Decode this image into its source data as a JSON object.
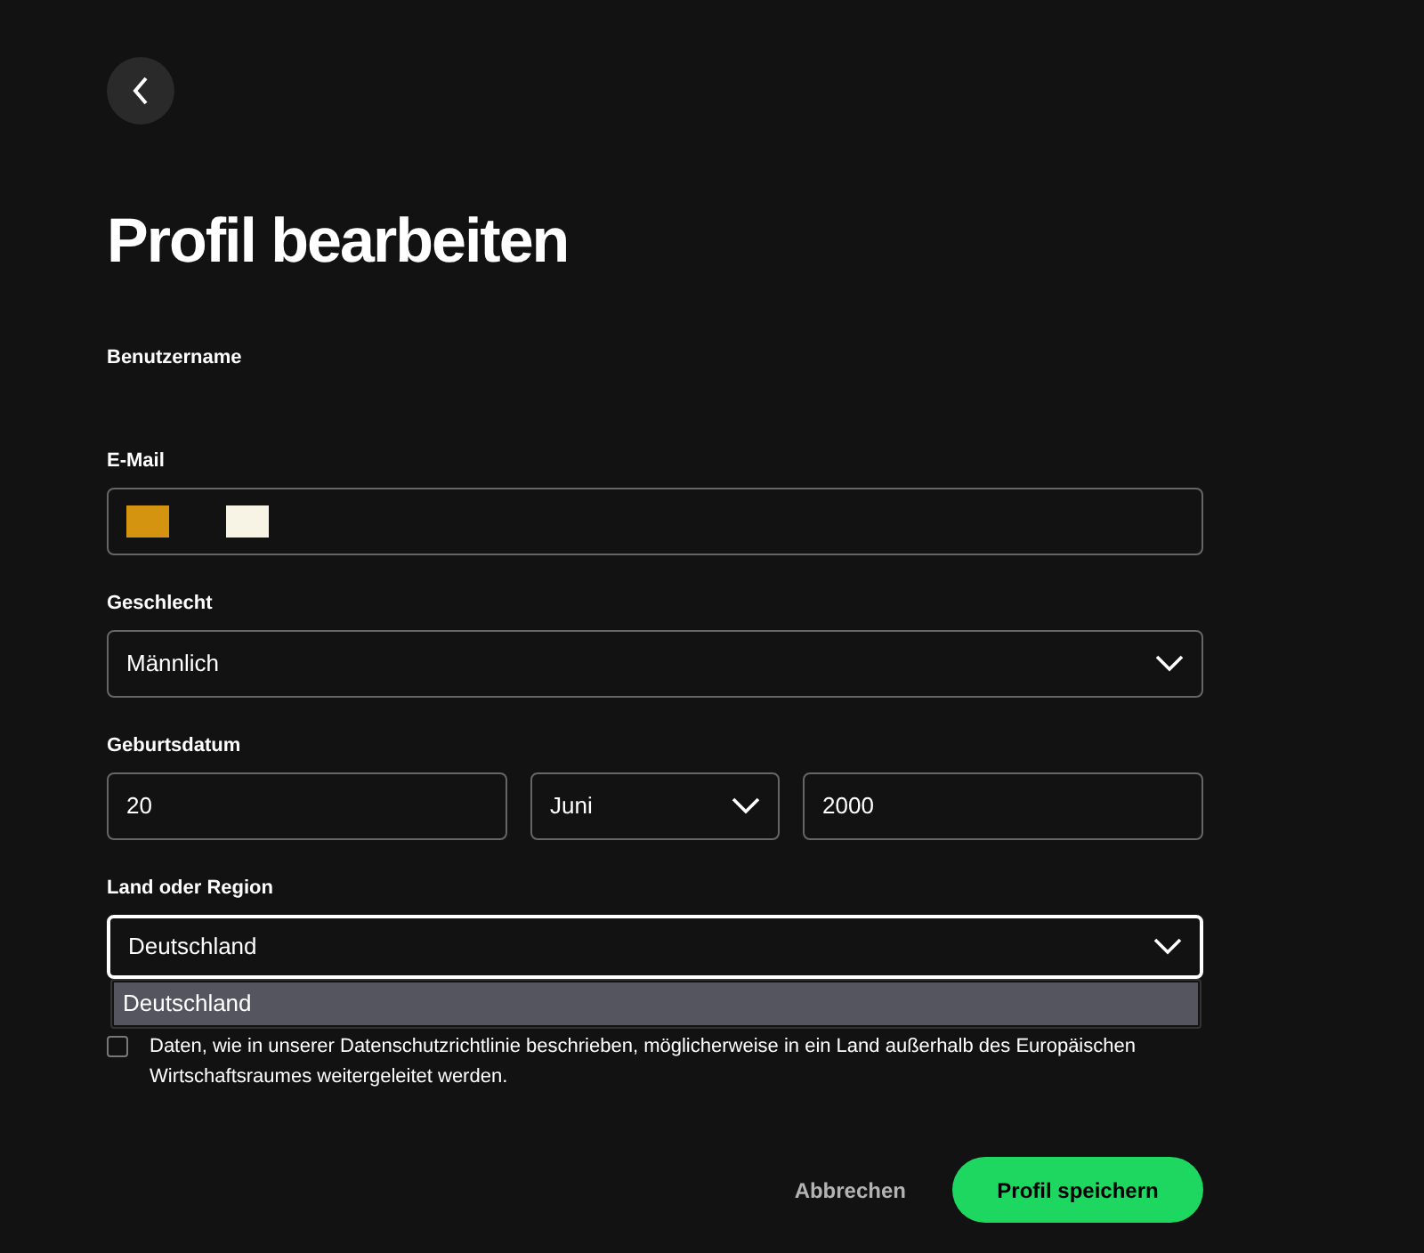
{
  "title": "Profil bearbeiten",
  "username": {
    "label": "Benutzername"
  },
  "email": {
    "label": "E-Mail"
  },
  "gender": {
    "label": "Geschlecht",
    "value": "Männlich"
  },
  "birthdate": {
    "label": "Geburtsdatum",
    "day": "20",
    "month": "Juni",
    "year": "2000"
  },
  "country": {
    "label": "Land oder Region",
    "value": "Deutschland",
    "focused": true,
    "options": [
      {
        "label": "Deutschland",
        "selected": true
      }
    ]
  },
  "consent": {
    "checked": false,
    "text": "Daten, wie in unserer Datenschutzrichtlinie beschrieben, möglicherweise in ein Land außerhalb des Europäischen Wirtschaftsraumes weitergeleitet werden."
  },
  "buttons": {
    "cancel": "Abbrechen",
    "save": "Profil speichern"
  }
}
